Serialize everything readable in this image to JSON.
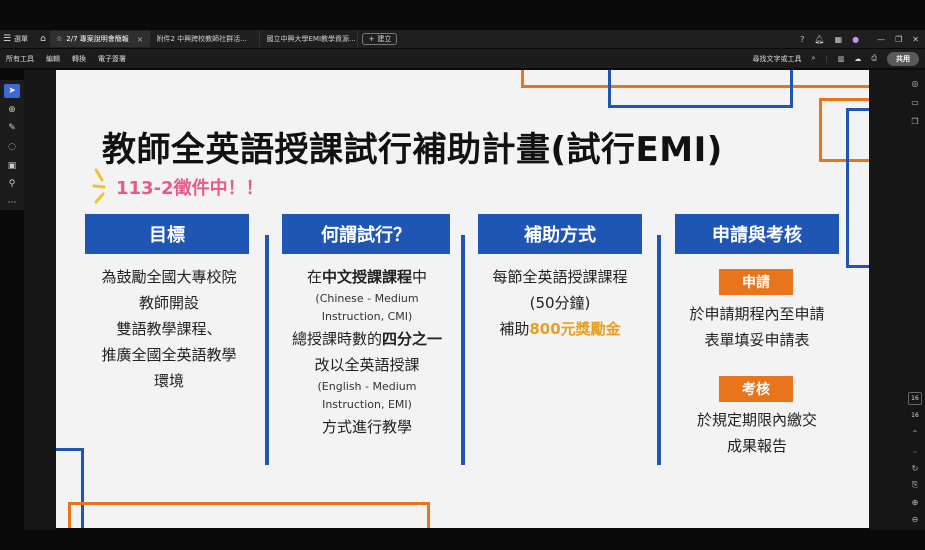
{
  "browser": {
    "menu_label": "選單",
    "tabs": [
      {
        "label": "2/7 專案說明會簡報",
        "active": true
      },
      {
        "label": "附件2 中興跨校教師社群活..."
      },
      {
        "label": "國立中興大學EMI教學資源..."
      }
    ],
    "new_tab": "建立"
  },
  "toolbar": {
    "menus": [
      "所有工具",
      "編輯",
      "轉換",
      "電子簽署"
    ],
    "search_label": "尋找文字或工具",
    "share_label": "共用"
  },
  "viewer": {
    "page_current": "16",
    "page_total": "16"
  },
  "slide": {
    "title": "教師全英語授課試行補助計畫(試行EMI)",
    "badge": "113-2徵件中！！",
    "columns": [
      {
        "heading": "目標",
        "lines": [
          "為鼓勵全國大專校院",
          "教師開設",
          "雙語教學課程、",
          "推廣全國全英語教學",
          "環境"
        ]
      },
      {
        "heading": "何謂試行？",
        "line1_pre": "在",
        "line1_em": "中文授課課程",
        "line1_post": "中",
        "sub1a": "(Chinese - Medium",
        "sub1b": "Instruction, CMI)",
        "line2_pre": "總授課時數的",
        "line2_em": "四分之一",
        "line3": "改以全英語授課",
        "sub2a": "(English - Medium",
        "sub2b": "Instruction, EMI)",
        "line4": "方式進行教學"
      },
      {
        "heading": "補助方式",
        "line1": "每節全英語授課課程",
        "line2": "(50分鐘)",
        "line3_pre": "補助",
        "line3_em": "800元獎勵金"
      },
      {
        "heading": "申請與考核",
        "tag1": "申請",
        "tag1_lines": [
          "於申請期程內至申請",
          "表單填妥申請表"
        ],
        "tag2": "考核",
        "tag2_lines": [
          "於規定期限內繳交",
          "成果報告"
        ]
      }
    ]
  },
  "colors": {
    "blue": "#1f55b3",
    "orange": "#e8741c",
    "pink": "#e85a8a",
    "gold": "#e8a020"
  }
}
